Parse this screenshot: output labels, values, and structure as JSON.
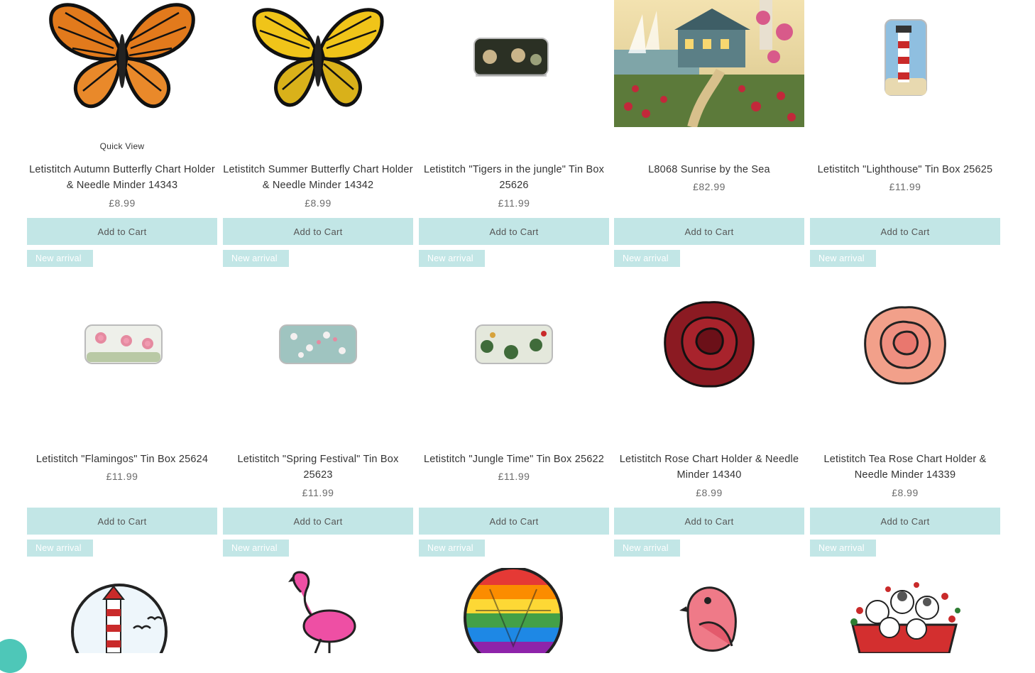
{
  "quick_view_label": "Quick View",
  "products": [
    {
      "title": "Letistitch Autumn Butterfly Chart Holder & Needle Minder 14343",
      "price": "£8.99",
      "button": "Add to Cart",
      "ribbon": "New arrival",
      "image": "orange-monarch-butterfly"
    },
    {
      "title": "Letistitch Summer Butterfly Chart Holder & Needle Minder 14342",
      "price": "£8.99",
      "button": "Add to Cart",
      "ribbon": "New arrival",
      "image": "yellow-butterfly"
    },
    {
      "title": "Letistitch \"Tigers in the jungle\" Tin Box 25626",
      "price": "£11.99",
      "button": "Add to Cart",
      "ribbon": "New arrival",
      "image": "tigers-tin-box"
    },
    {
      "title": "L8068 Sunrise by the Sea",
      "price": "£82.99",
      "button": "Add to Cart",
      "ribbon": "New arrival",
      "image": "seaside-cottage-painting"
    },
    {
      "title": "Letistitch \"Lighthouse\" Tin Box 25625",
      "price": "£11.99",
      "button": "Add to Cart",
      "ribbon": "New arrival",
      "image": "lighthouse-tin-box"
    },
    {
      "title": "Letistitch \"Flamingos\" Tin Box 25624",
      "price": "£11.99",
      "button": "Add to Cart",
      "ribbon": "New arrival",
      "image": "flamingos-tin-box"
    },
    {
      "title": "Letistitch \"Spring Festival\" Tin Box 25623",
      "price": "£11.99",
      "button": "Add to Cart",
      "ribbon": "New arrival",
      "image": "spring-festival-tin-box"
    },
    {
      "title": "Letistitch \"Jungle Time\" Tin Box 25622",
      "price": "£11.99",
      "button": "Add to Cart",
      "ribbon": "New arrival",
      "image": "jungle-time-tin-box"
    },
    {
      "title": "Letistitch Rose Chart Holder & Needle Minder 14340",
      "price": "£8.99",
      "button": "Add to Cart",
      "ribbon": "New arrival",
      "image": "red-rose-pin"
    },
    {
      "title": "Letistitch Tea Rose Chart Holder & Needle Minder 14339",
      "price": "£8.99",
      "button": "Add to Cart",
      "ribbon": "New arrival",
      "image": "pink-rose-pin"
    },
    {
      "image": "lighthouse-round-pin"
    },
    {
      "image": "flamingo-pin"
    },
    {
      "image": "hot-air-balloon-pin"
    },
    {
      "image": "pink-bird-pin"
    },
    {
      "image": "cats-teacup-pin"
    }
  ],
  "colors": {
    "button_bg": "#c2e6e6",
    "ribbon_bg": "#c2e6e6",
    "chat_bubble": "#4ec7b8"
  }
}
